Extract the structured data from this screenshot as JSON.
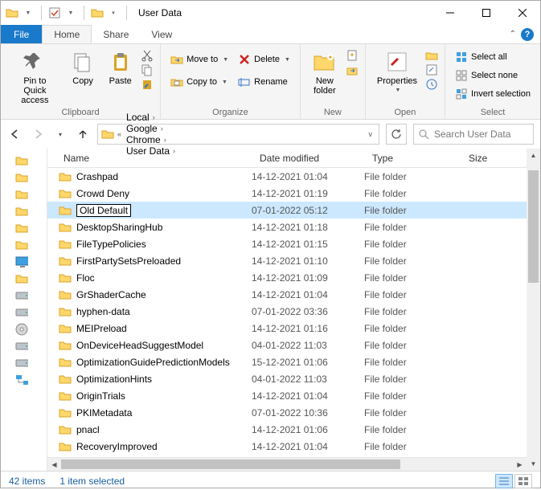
{
  "window": {
    "title": "User Data"
  },
  "tabs": {
    "file": "File",
    "home": "Home",
    "share": "Share",
    "view": "View"
  },
  "ribbon": {
    "clipboard": {
      "label": "Clipboard",
      "pin": "Pin to Quick\naccess",
      "copy": "Copy",
      "paste": "Paste"
    },
    "organize": {
      "label": "Organize",
      "move": "Move to",
      "copy": "Copy to",
      "delete": "Delete",
      "rename": "Rename"
    },
    "new": {
      "label": "New",
      "folder": "New\nfolder"
    },
    "open": {
      "label": "Open",
      "properties": "Properties"
    },
    "select": {
      "label": "Select",
      "all": "Select all",
      "none": "Select none",
      "invert": "Invert selection"
    }
  },
  "breadcrumbs": [
    "Local",
    "Google",
    "Chrome",
    "User Data"
  ],
  "search_placeholder": "Search User Data",
  "columns": {
    "name": "Name",
    "date": "Date modified",
    "type": "Type",
    "size": "Size"
  },
  "type_folder": "File folder",
  "rows": [
    {
      "name": "Crashpad",
      "date": "14-12-2021 01:04",
      "sel": false
    },
    {
      "name": "Crowd Deny",
      "date": "14-12-2021 01:19",
      "sel": false
    },
    {
      "name": "Old Default",
      "date": "07-01-2022 05:12",
      "sel": true,
      "rename": true
    },
    {
      "name": "DesktopSharingHub",
      "date": "14-12-2021 01:18",
      "sel": false
    },
    {
      "name": "FileTypePolicies",
      "date": "14-12-2021 01:15",
      "sel": false
    },
    {
      "name": "FirstPartySetsPreloaded",
      "date": "14-12-2021 01:10",
      "sel": false
    },
    {
      "name": "Floc",
      "date": "14-12-2021 01:09",
      "sel": false
    },
    {
      "name": "GrShaderCache",
      "date": "14-12-2021 01:04",
      "sel": false
    },
    {
      "name": "hyphen-data",
      "date": "07-01-2022 03:36",
      "sel": false
    },
    {
      "name": "MEIPreload",
      "date": "14-12-2021 01:16",
      "sel": false
    },
    {
      "name": "OnDeviceHeadSuggestModel",
      "date": "04-01-2022 11:03",
      "sel": false
    },
    {
      "name": "OptimizationGuidePredictionModels",
      "date": "15-12-2021 01:06",
      "sel": false
    },
    {
      "name": "OptimizationHints",
      "date": "04-01-2022 11:03",
      "sel": false
    },
    {
      "name": "OriginTrials",
      "date": "14-12-2021 01:04",
      "sel": false
    },
    {
      "name": "PKIMetadata",
      "date": "07-01-2022 10:36",
      "sel": false
    },
    {
      "name": "pnacl",
      "date": "14-12-2021 01:06",
      "sel": false
    },
    {
      "name": "RecoveryImproved",
      "date": "14-12-2021 01:04",
      "sel": false
    }
  ],
  "status": {
    "items": "42 items",
    "selected": "1 item selected"
  }
}
